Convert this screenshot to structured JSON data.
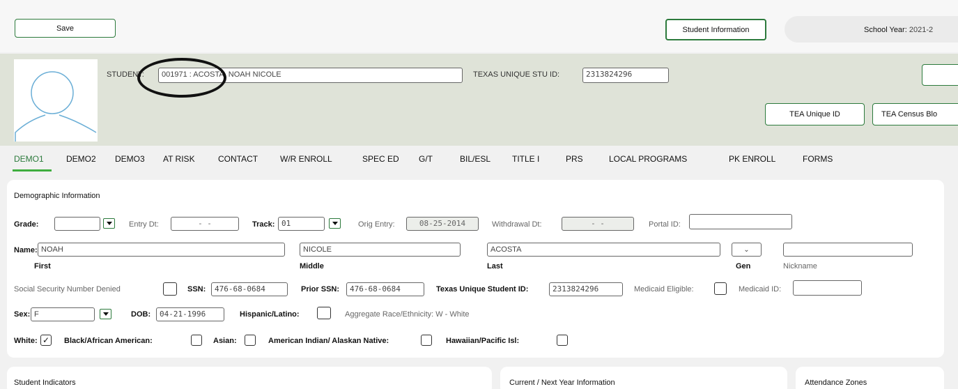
{
  "toolbar": {
    "save": "Save",
    "student_info": "Student Information",
    "school_year_label": "School Year:",
    "school_year_value": "2021-2"
  },
  "header": {
    "student_label": "STUDENT:",
    "student_value": "001971 : ACOSTA, NOAH NICOLE",
    "texas_id_label": "TEXAS UNIQUE STU ID:",
    "texas_id_value": "2313824296",
    "tea_unique_id": "TEA Unique ID",
    "tea_census": "TEA Census Blo"
  },
  "tabs": [
    "DEMO1",
    "DEMO2",
    "DEMO3",
    "AT RISK",
    "CONTACT",
    "W/R ENROLL",
    "SPEC ED",
    "G/T",
    "BIL/ESL",
    "TITLE I",
    "PRS",
    "LOCAL PROGRAMS",
    "PK ENROLL",
    "FORMS"
  ],
  "demo": {
    "section_title": "Demographic Information",
    "grade_label": "Grade:",
    "grade_value": "",
    "entry_dt_label": "Entry Dt:",
    "entry_dt_value": "-   -",
    "track_label": "Track:",
    "track_value": "01",
    "orig_entry_label": "Orig Entry:",
    "orig_entry_value": "08-25-2014",
    "withdrawal_label": "Withdrawal Dt:",
    "withdrawal_value": "-   -",
    "portal_label": "Portal ID:",
    "portal_value": "",
    "name_label": "Name:",
    "first_value": "NOAH",
    "middle_value": "NICOLE",
    "last_value": "ACOSTA",
    "nickname_value": "",
    "first_caption": "First",
    "middle_caption": "Middle",
    "last_caption": "Last",
    "gen_caption": "Gen",
    "nickname_caption": "Nickname",
    "ssn_denied_label": "Social Security Number Denied",
    "ssn_label": "SSN:",
    "ssn_value": "476-68-0684",
    "prior_ssn_label": "Prior SSN:",
    "prior_ssn_value": "476-68-0684",
    "tx_student_id_label": "Texas Unique Student ID:",
    "tx_student_id_value": "2313824296",
    "medicaid_eligible_label": "Medicaid Eligible:",
    "medicaid_id_label": "Medicaid ID:",
    "medicaid_id_value": "",
    "sex_label": "Sex:",
    "sex_value": "F",
    "dob_label": "DOB:",
    "dob_value": "04-21-1996",
    "hispanic_label": "Hispanic/Latino:",
    "aggregate_race": "Aggregate Race/Ethnicity: W - White",
    "white_label": "White:",
    "white_checked": "✓",
    "black_label": "Black/African American:",
    "asian_label": "Asian:",
    "amind_label": "American Indian/ Alaskan Native:",
    "hawaiian_label": "Hawaiian/Pacific Isl:"
  },
  "bottom": {
    "student_indicators": "Student Indicators",
    "current_next": "Current / Next Year Information",
    "attendance_zones": "Attendance Zones"
  }
}
